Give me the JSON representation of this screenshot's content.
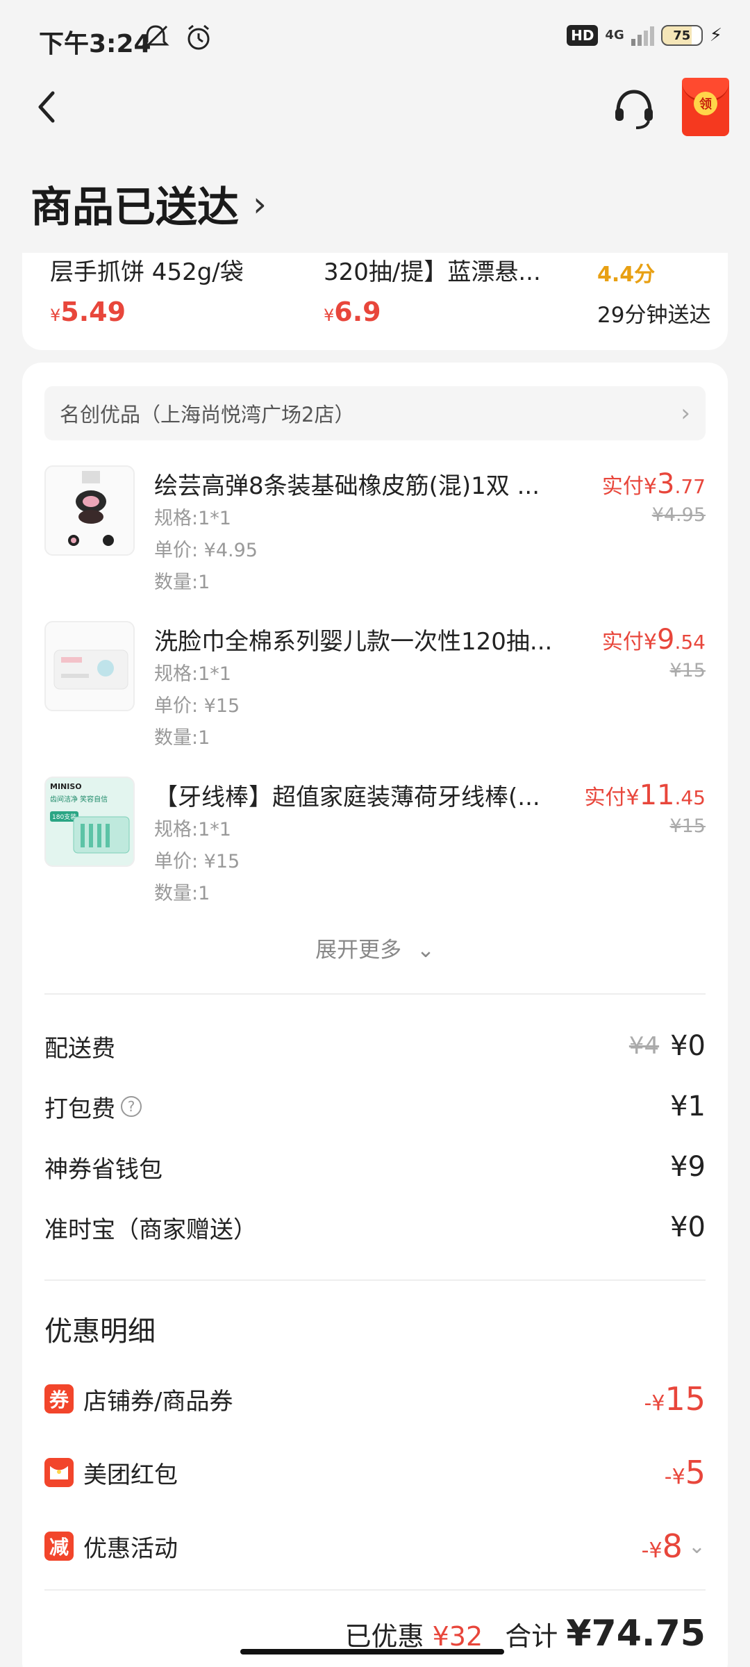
{
  "status_bar": {
    "time": "下午3:24",
    "hd": "HD",
    "network": "4G",
    "battery": "75",
    "icons": [
      "mute-icon",
      "alarm-icon",
      "signal-icon",
      "charging-icon"
    ]
  },
  "header": {
    "title": "商品已送达",
    "redpack_label": "领"
  },
  "top_card": {
    "items": [
      {
        "name": "层手抓饼 452g/袋",
        "currency": "¥",
        "price": "5.49"
      },
      {
        "name": "320抽/提】蓝漂悬...",
        "currency": "¥",
        "price": "6.9"
      }
    ],
    "score": "4.4分",
    "eta": "29分钟送达"
  },
  "store": {
    "name": "名创优品（上海尚悦湾广场2店）"
  },
  "items": [
    {
      "title": "绘芸高弹8条装基础橡皮筋(混)1双 ...",
      "spec": "规格:1*1",
      "unit_price": "单价: ¥4.95",
      "qty": "数量:1",
      "paid_prefix": "实付¥",
      "paid_int": "3",
      "paid_dec": ".77",
      "orig": "¥4.95"
    },
    {
      "title": "洗脸巾全棉系列婴儿款一次性120抽...",
      "spec": "规格:1*1",
      "unit_price": "单价: ¥15",
      "qty": "数量:1",
      "paid_prefix": "实付¥",
      "paid_int": "9",
      "paid_dec": ".54",
      "orig": "¥15"
    },
    {
      "title": "【牙线棒】超值家庭装薄荷牙线棒(...",
      "spec": "规格:1*1",
      "unit_price": "单价: ¥15",
      "qty": "数量:1",
      "paid_prefix": "实付¥",
      "paid_int": "11",
      "paid_dec": ".45",
      "orig": "¥15",
      "thumb_brand": "MINISO",
      "thumb_text1": "齿间洁净 笑容自信",
      "thumb_text2": "180支装"
    }
  ],
  "expand_label": "展开更多",
  "fees": [
    {
      "label": "配送费",
      "old": "¥4",
      "value": "¥0"
    },
    {
      "label": "打包费",
      "value": "¥1"
    },
    {
      "label": "神券省钱包",
      "value": "¥9"
    },
    {
      "label": "准时宝（商家赠送）",
      "value": "¥0"
    }
  ],
  "discount_title": "优惠明细",
  "discounts": [
    {
      "tag": "券",
      "label": "店铺券/商品券",
      "prefix": "-¥",
      "value": "15"
    },
    {
      "tag": "",
      "label": "美团红包",
      "prefix": "-¥",
      "value": "5"
    },
    {
      "tag": "减",
      "label": "优惠活动",
      "prefix": "-¥",
      "value": "8"
    }
  ],
  "total": {
    "saved_label": "已优惠",
    "saved_value": "¥32",
    "sum_label": "合计",
    "sum_value": "¥74.75"
  },
  "colors": {
    "accent_red": "#e8463b",
    "score_orange": "#e8a013",
    "tag_red": "#f2452b"
  }
}
